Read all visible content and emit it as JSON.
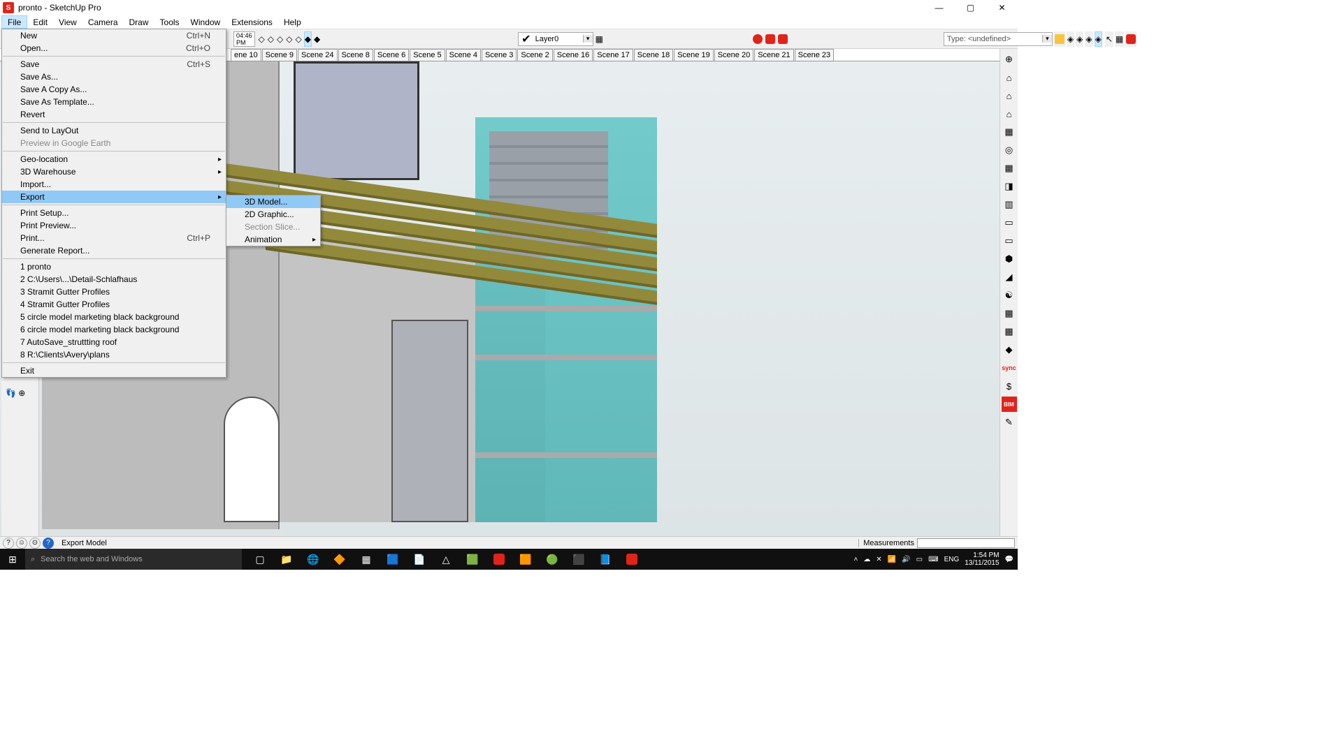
{
  "window": {
    "title": "pronto - SketchUp Pro"
  },
  "menubar": [
    "File",
    "Edit",
    "View",
    "Camera",
    "Draw",
    "Tools",
    "Window",
    "Extensions",
    "Help"
  ],
  "toolbar": {
    "time": "04:46 PM",
    "layer": "Layer0",
    "type": "Type: <undefined>"
  },
  "scenes": [
    "ene 10",
    "Scene 9",
    "Scene 24",
    "Scene 8",
    "Scene 6",
    "Scene 5",
    "Scene 4",
    "Scene 3",
    "Scene 2",
    "Scene 16",
    "Scene 17",
    "Scene 18",
    "Scene 19",
    "Scene 20",
    "Scene 21",
    "Scene 23"
  ],
  "file_menu": {
    "groups": [
      [
        {
          "l": "New",
          "s": "Ctrl+N"
        },
        {
          "l": "Open...",
          "s": "Ctrl+O"
        }
      ],
      [
        {
          "l": "Save",
          "s": "Ctrl+S"
        },
        {
          "l": "Save As..."
        },
        {
          "l": "Save A Copy As..."
        },
        {
          "l": "Save As Template..."
        },
        {
          "l": "Revert"
        }
      ],
      [
        {
          "l": "Send to LayOut"
        },
        {
          "l": "Preview in Google Earth",
          "disabled": true
        }
      ],
      [
        {
          "l": "Geo-location",
          "sub": true
        },
        {
          "l": "3D Warehouse",
          "sub": true
        },
        {
          "l": "Import..."
        },
        {
          "l": "Export",
          "sub": true,
          "hl": true
        }
      ],
      [
        {
          "l": "Print Setup..."
        },
        {
          "l": "Print Preview..."
        },
        {
          "l": "Print...",
          "s": "Ctrl+P"
        },
        {
          "l": "Generate Report..."
        }
      ],
      [
        {
          "l": "1 pronto"
        },
        {
          "l": "2 C:\\Users\\...\\Detail-Schlafhaus"
        },
        {
          "l": "3 Stramit Gutter Profiles"
        },
        {
          "l": "4 Stramit Gutter Profiles"
        },
        {
          "l": "5 circle model marketing black background"
        },
        {
          "l": "6 circle model marketing black background"
        },
        {
          "l": "7 AutoSave_struttting roof"
        },
        {
          "l": "8 R:\\Clients\\Avery\\plans"
        }
      ],
      [
        {
          "l": "Exit"
        }
      ]
    ]
  },
  "export_submenu": [
    {
      "l": "3D Model...",
      "hl": true
    },
    {
      "l": "2D Graphic..."
    },
    {
      "l": "Section Slice...",
      "disabled": true
    },
    {
      "l": "Animation",
      "sub": true
    }
  ],
  "right_tools": [
    "⊕",
    "⌂",
    "⌂",
    "⌂",
    "▦",
    "◎",
    "▦",
    "◨",
    "▥",
    "▭",
    "▭",
    "⬢",
    "◢",
    "☯",
    "▦",
    "▦",
    "◆",
    "sync",
    "$",
    "BIM",
    "✎"
  ],
  "status": {
    "hint": "Export Model",
    "measurements": "Measurements"
  },
  "taskbar": {
    "search_placeholder": "Search the web and Windows",
    "lang": "ENG",
    "time": "1:54 PM",
    "date": "13/11/2015"
  }
}
